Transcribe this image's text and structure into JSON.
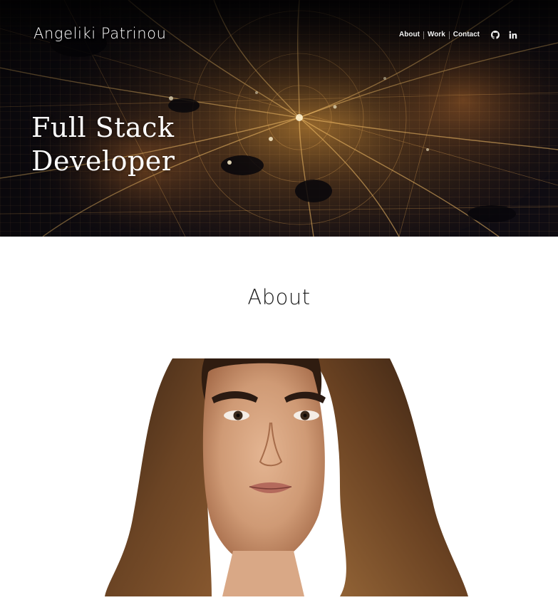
{
  "header": {
    "brand": "Angeliki Patrinou",
    "nav": [
      {
        "label": "About"
      },
      {
        "label": "Work"
      },
      {
        "label": "Contact"
      }
    ],
    "icons": [
      "github-icon",
      "linkedin-icon"
    ]
  },
  "hero": {
    "headline_line1": "Full Stack",
    "headline_line2": "Developer",
    "background": "city-lights-at-night-aerial-photo"
  },
  "about": {
    "title": "About",
    "image": "portrait-photo"
  },
  "colors": {
    "hero_dark": "#0c0a10",
    "city_light": "#f3b457",
    "text_light": "#ffffff",
    "text_dark": "#1a1a1a",
    "page_bg": "#ffffff"
  }
}
